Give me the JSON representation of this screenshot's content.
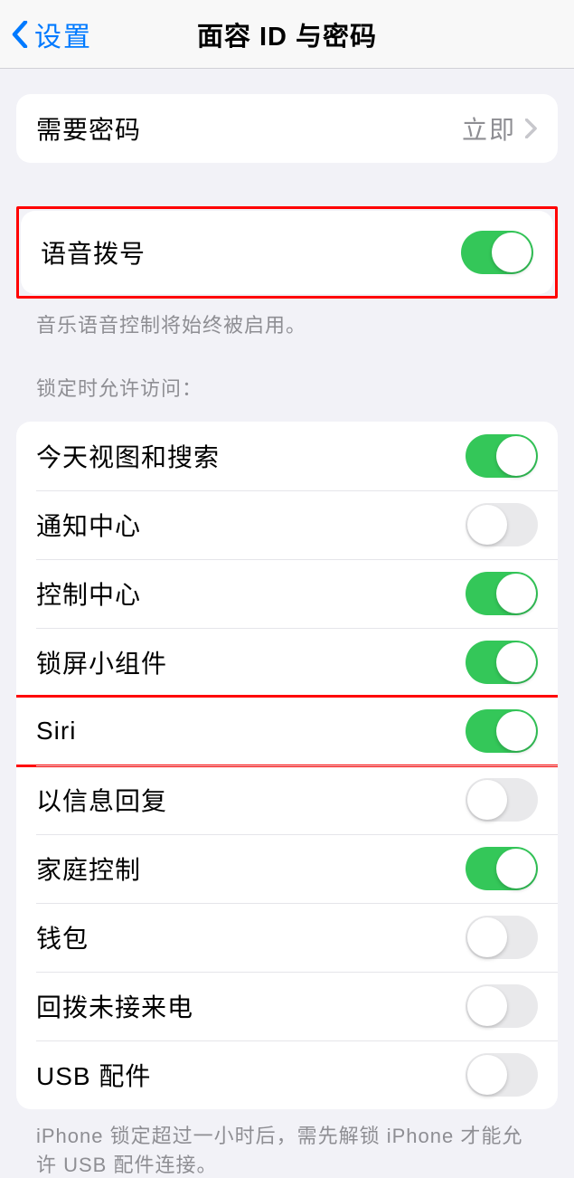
{
  "header": {
    "back_label": "设置",
    "title": "面容 ID 与密码"
  },
  "require_passcode": {
    "label": "需要密码",
    "value": "立即"
  },
  "voice_dial": {
    "label": "语音拨号",
    "on": true,
    "footer": "音乐语音控制将始终被启用。"
  },
  "lock_access": {
    "header": "锁定时允许访问：",
    "items": [
      {
        "label": "今天视图和搜索",
        "on": true
      },
      {
        "label": "通知中心",
        "on": false
      },
      {
        "label": "控制中心",
        "on": true
      },
      {
        "label": "锁屏小组件",
        "on": true
      },
      {
        "label": "Siri",
        "on": true
      },
      {
        "label": "以信息回复",
        "on": false
      },
      {
        "label": "家庭控制",
        "on": true
      },
      {
        "label": "钱包",
        "on": false
      },
      {
        "label": "回拨未接来电",
        "on": false
      },
      {
        "label": "USB 配件",
        "on": false
      }
    ],
    "footer": "iPhone 锁定超过一小时后，需先解锁 iPhone 才能允许 USB 配件连接。"
  },
  "highlighted_indices": [
    4
  ]
}
